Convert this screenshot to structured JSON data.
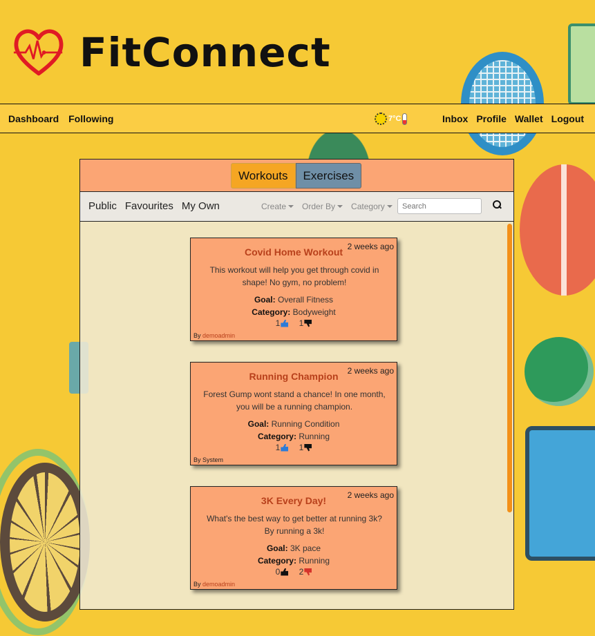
{
  "app": {
    "name": "FitConnect"
  },
  "nav": {
    "left": [
      "Dashboard",
      "Following"
    ],
    "right": [
      "Inbox",
      "Profile",
      "Wallet",
      "Logout"
    ],
    "weather_temp": "7°C"
  },
  "toggle": {
    "active": "Workouts",
    "inactive": "Exercises"
  },
  "filters": {
    "tabs": [
      "Public",
      "Favourites",
      "My Own"
    ],
    "dropdowns": [
      "Create",
      "Order By",
      "Category"
    ],
    "search_placeholder": "Search"
  },
  "cards": [
    {
      "time": "2 weeks ago",
      "title": "Covid Home Workout",
      "description": "This workout will help you get through covid in shape! No gym, no problem!",
      "goal_label": "Goal:",
      "goal": "Overall Fitness",
      "category_label": "Category:",
      "category": "Bodyweight",
      "likes": "1",
      "dislikes": "1",
      "by_label": "By",
      "author": "demoadmin"
    },
    {
      "time": "2 weeks ago",
      "title": "Running Champion",
      "description": "Forest Gump wont stand a chance! In one month, you will be a running champion.",
      "goal_label": "Goal:",
      "goal": "Running Condition",
      "category_label": "Category:",
      "category": "Running",
      "likes": "1",
      "dislikes": "1",
      "by_label": "By",
      "author": "System"
    },
    {
      "time": "2 weeks ago",
      "title": "3K Every Day!",
      "description": "What's the best way to get better at running 3k? By running a 3k!",
      "goal_label": "Goal:",
      "goal": "3K pace",
      "category_label": "Category:",
      "category": "Running",
      "likes": "0",
      "dislikes": "2",
      "by_label": "By",
      "author": "demoadmin"
    }
  ],
  "colors": {
    "background": "#f6c935",
    "navbar": "#fbcd44",
    "card": "#fba574",
    "title_accent": "#b8401b",
    "active_toggle": "#f5a623",
    "inactive_toggle": "#6f8fa7",
    "scrollbar": "#f39018"
  },
  "icons": [
    "heart-pulse-logo-icon",
    "sun-icon",
    "thermometer-icon",
    "search-icon",
    "thumbs-up-icon",
    "thumbs-down-icon"
  ]
}
